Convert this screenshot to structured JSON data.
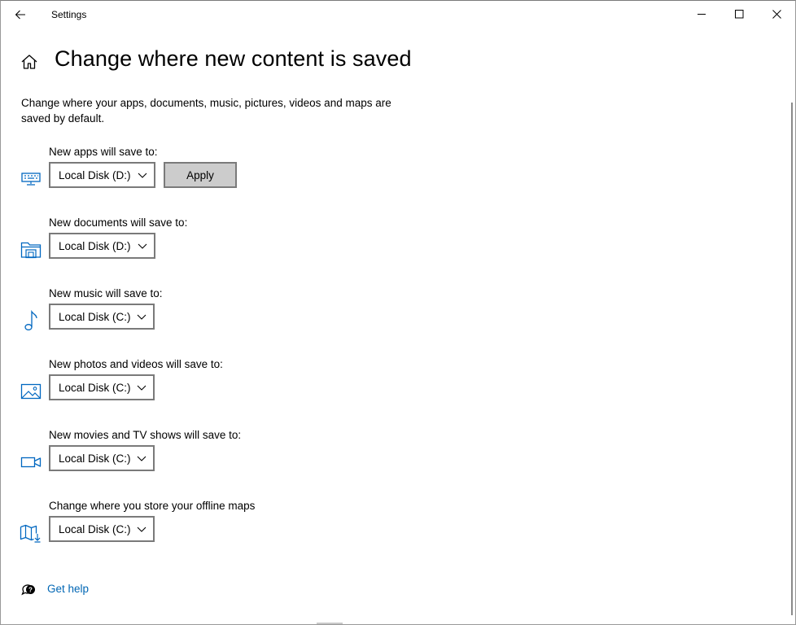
{
  "window": {
    "title": "Settings"
  },
  "header": {
    "title": "Change where new content is saved"
  },
  "description": "Change where your apps, documents, music, pictures, videos and maps are saved by default.",
  "settings": [
    {
      "label": "New apps will save to:",
      "value": "Local Disk (D:)",
      "icon": "monitor-keyboard-icon",
      "apply_label": "Apply"
    },
    {
      "label": "New documents will save to:",
      "value": "Local Disk (D:)",
      "icon": "document-folder-icon"
    },
    {
      "label": "New music will save to:",
      "value": "Local Disk (C:)",
      "icon": "music-note-icon"
    },
    {
      "label": "New photos and videos will save to:",
      "value": "Local Disk (C:)",
      "icon": "picture-icon"
    },
    {
      "label": "New movies and TV shows will save to:",
      "value": "Local Disk (C:)",
      "icon": "video-camera-icon"
    },
    {
      "label": "Change where you store your offline maps",
      "value": "Local Disk (C:)",
      "icon": "map-download-icon"
    }
  ],
  "help": {
    "label": "Get help",
    "icon": "help-chat-icon"
  },
  "colors": {
    "accent": "#0066b4",
    "icon": "#0067c0",
    "apply_bg": "#cccccc",
    "border": "#7a7a7a"
  }
}
